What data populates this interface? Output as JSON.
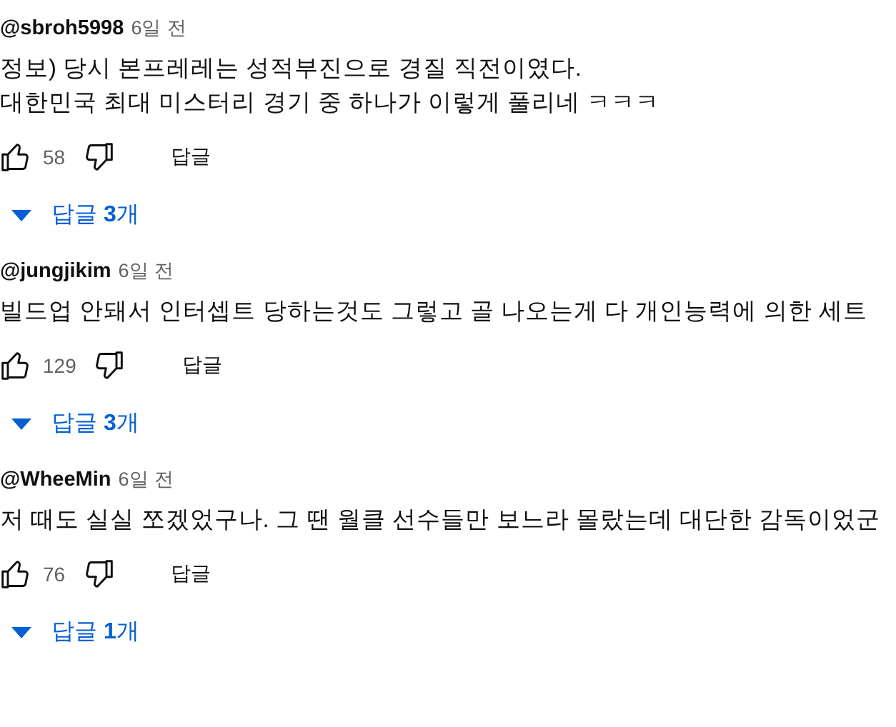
{
  "comments": [
    {
      "author": "@sbroh5998",
      "time": "6일 전",
      "lines": [
        "정보) 당시 본프레레는 성적부진으로 경질 직전이였다.",
        "대한민국 최대 미스터리 경기 중 하나가 이렇게 풀리네 ㅋㅋㅋ"
      ],
      "likes": "58",
      "reply_button": "답글",
      "replies": {
        "label": "답글 ",
        "count": "3",
        "suffix": "개"
      }
    },
    {
      "author": "@jungjikim",
      "time": "6일 전",
      "lines": [
        "빌드업 안돼서 인터셉트 당하는것도 그렇고 골 나오는게 다 개인능력에 의한 세트"
      ],
      "likes": "129",
      "reply_button": "답글",
      "replies": {
        "label": "답글 ",
        "count": "3",
        "suffix": "개"
      }
    },
    {
      "author": "@WheeMin",
      "time": "6일 전",
      "lines": [
        "저 때도 실실 쪼겠었구나. 그 땐 월클 선수들만 보느라 몰랐는데 대단한 감독이었군"
      ],
      "likes": "76",
      "reply_button": "답글",
      "replies": {
        "label": "답글 ",
        "count": "1",
        "suffix": "개"
      }
    }
  ]
}
